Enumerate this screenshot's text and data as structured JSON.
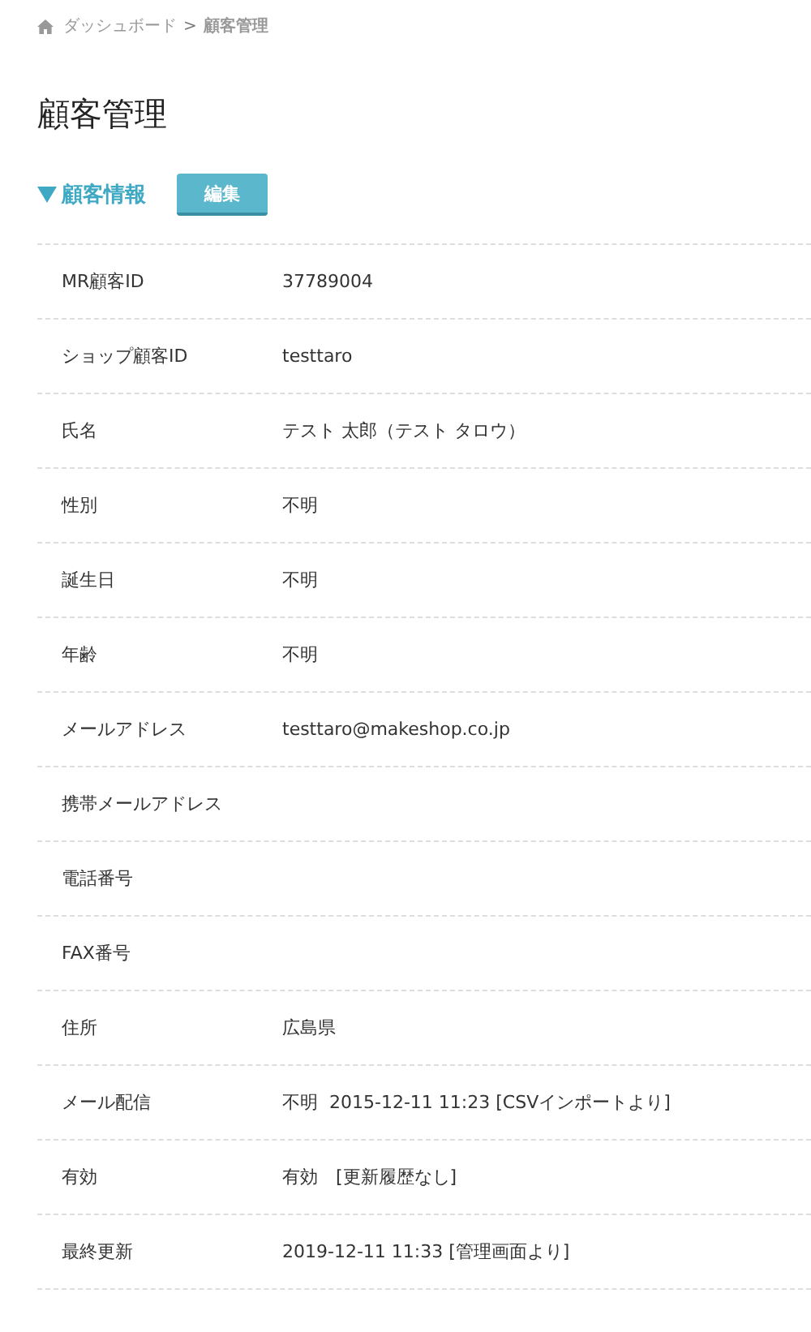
{
  "breadcrumb": {
    "items": [
      {
        "label": "ダッシュボード",
        "current": false
      },
      {
        "label": "顧客管理",
        "current": true
      }
    ],
    "separator": ">"
  },
  "page_title": "顧客管理",
  "section": {
    "title": "顧客情報",
    "expanded": true,
    "button": "編集"
  },
  "fields": [
    {
      "label": "MR顧客ID",
      "value": "37789004"
    },
    {
      "label": "ショップ顧客ID",
      "value": "testtaro"
    },
    {
      "label": "氏名",
      "value": "テスト 太郎（テスト タロウ）"
    },
    {
      "label": "性別",
      "value": "不明"
    },
    {
      "label": "誕生日",
      "value": "不明"
    },
    {
      "label": "年齢",
      "value": "不明"
    },
    {
      "label": "メールアドレス",
      "value": "testtaro@makeshop.co.jp"
    },
    {
      "label": "携帯メールアドレス"
    },
    {
      "label": "電話番号"
    },
    {
      "label": "FAX番号"
    },
    {
      "label": "住所",
      "value": "広島県"
    },
    {
      "label": "メール配信",
      "value": "不明  2015-12-11 11:23 [CSVインポートより]"
    },
    {
      "label": "有効",
      "value": "有効　[更新履歴なし]"
    },
    {
      "label": "最終更新",
      "value": "2019-12-11 11:33 [管理画面より]"
    }
  ]
}
